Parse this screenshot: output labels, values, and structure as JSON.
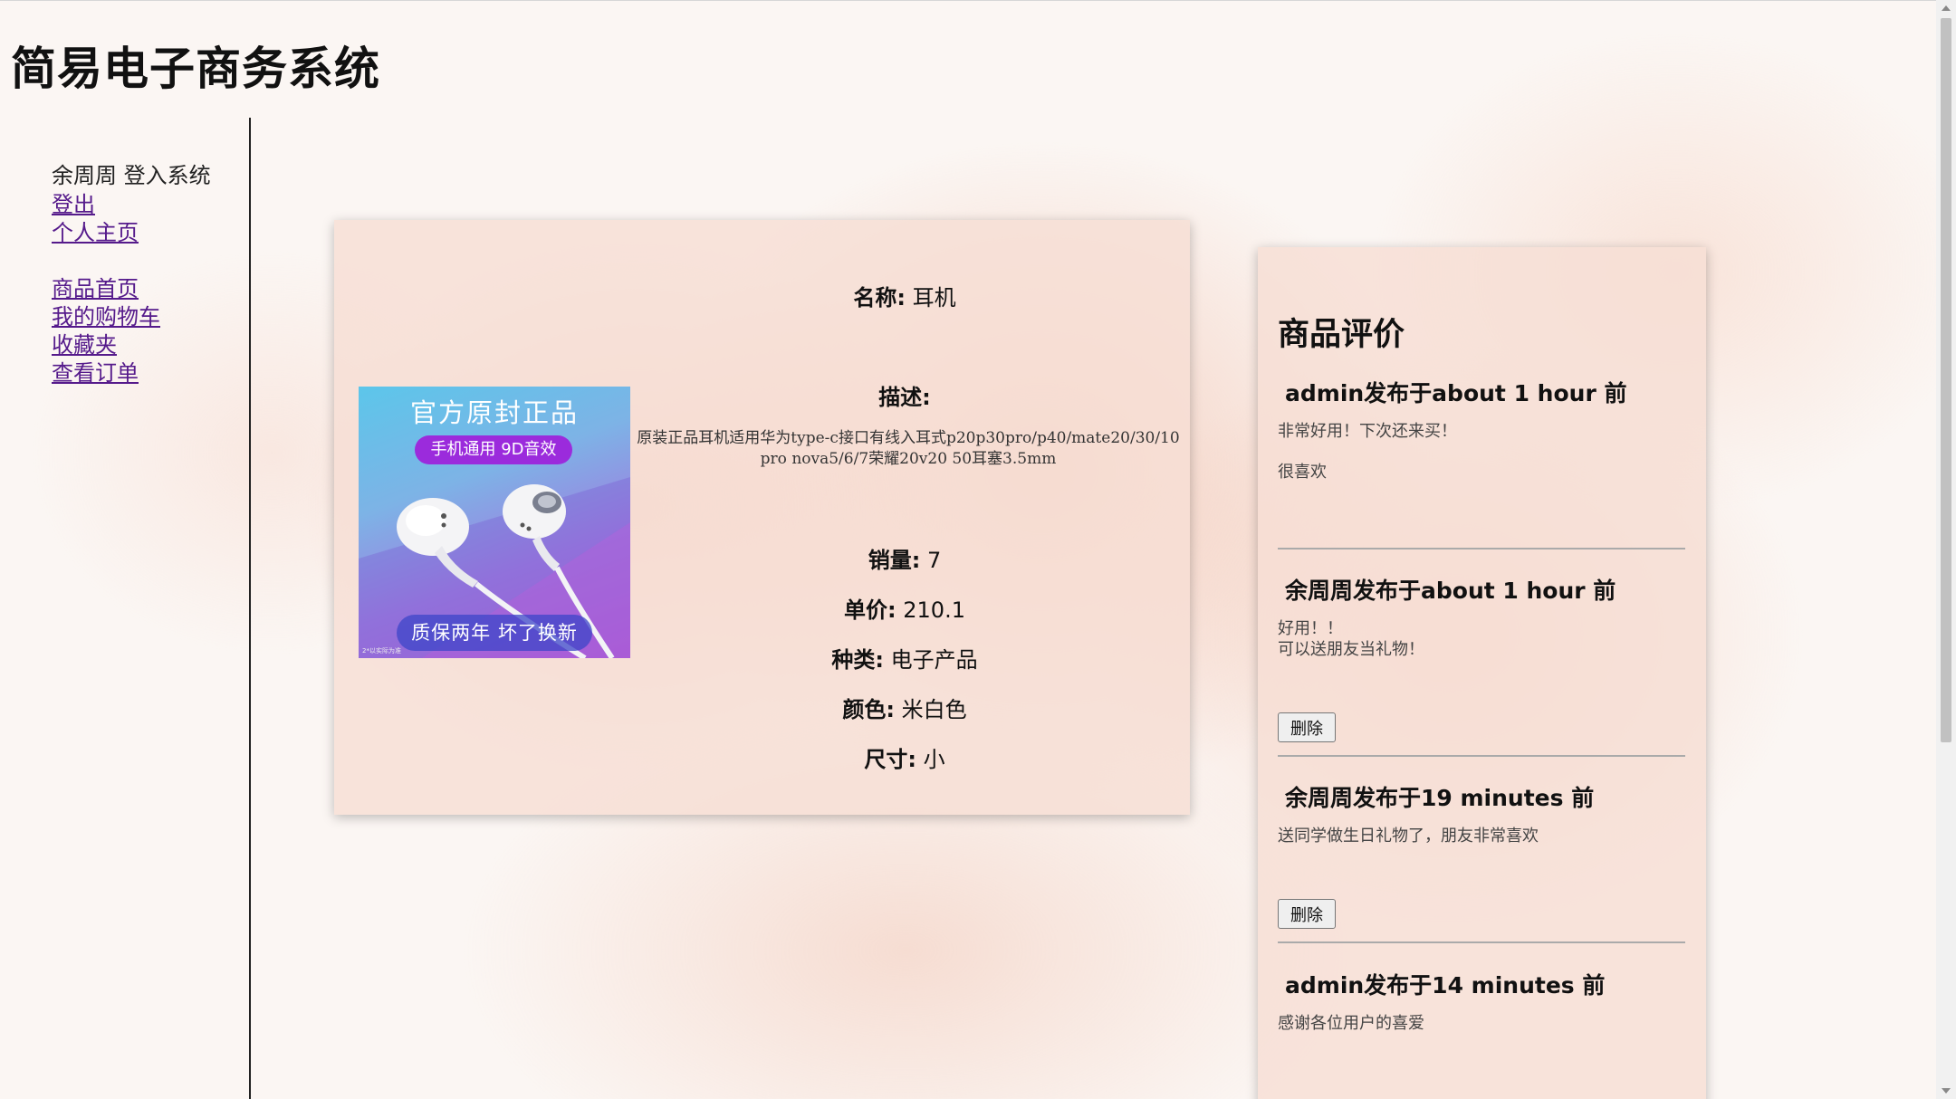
{
  "site": {
    "title": "简易电子商务系统"
  },
  "sidebar": {
    "status": "余周周 登入系统",
    "links": [
      "登出",
      "个人主页",
      "商品首页",
      "我的购物车",
      "收藏夹",
      "查看订单"
    ]
  },
  "product": {
    "image": {
      "headline": "官方原封正品",
      "pill": "手机通用 9D音效",
      "bottom": "质保两年 坏了换新",
      "fineprint": "2*以实际为准"
    },
    "name_label": "名称:",
    "name": "耳机",
    "desc_label": "描述:",
    "desc": "原装正品耳机适用华为type-c接口有线入耳式p20p30pro/p40/mate20/30/10pro nova5/6/7荣耀20v20 50耳塞3.5mm",
    "sales_label": "销量:",
    "sales": "7",
    "price_label": "单价:",
    "price": "210.1",
    "category_label": "种类:",
    "category": "电子产品",
    "color_label": "颜色:",
    "color": "米白色",
    "size_label": "尺寸:",
    "size": "小"
  },
  "reviews": {
    "title": "商品评价",
    "delete_label": "删除",
    "items": [
      {
        "author": "admin发布于about 1 hour 前",
        "lines": [
          "非常好用！下次还来买！",
          "很喜欢"
        ],
        "deletable": false
      },
      {
        "author": "余周周发布于about 1 hour 前",
        "lines": [
          "好用！！",
          "可以送朋友当礼物！"
        ],
        "deletable": true
      },
      {
        "author": "余周周发布于19 minutes 前",
        "lines": [
          "送同学做生日礼物了，朋友非常喜欢"
        ],
        "deletable": true
      },
      {
        "author": "admin发布于14 minutes 前",
        "lines": [
          "感谢各位用户的喜爱"
        ],
        "deletable": false
      }
    ]
  },
  "colors": {
    "link": "#551a8b",
    "card": "#f6ded4",
    "background": "#fbf6f3"
  }
}
